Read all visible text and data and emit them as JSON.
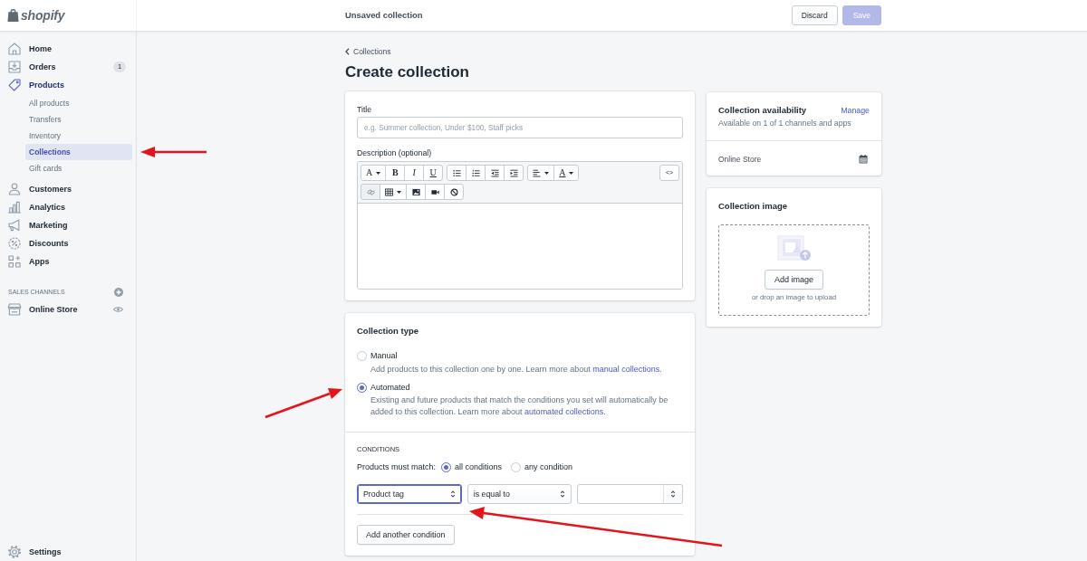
{
  "logo": "shopify",
  "top_bar": {
    "title": "Unsaved collection",
    "buttons": [
      {
        "label": "Discard",
        "kind": "secondary",
        "disabled": false
      },
      {
        "label": "Save",
        "kind": "primary",
        "disabled": true
      }
    ]
  },
  "sidebar": {
    "items": [
      {
        "label": "Home",
        "selected": false
      },
      {
        "label": "Orders",
        "selected": false,
        "badge": "1"
      },
      {
        "label": "Products",
        "selected": true,
        "children": [
          {
            "label": "All products",
            "selected": false
          },
          {
            "label": "Transfers",
            "selected": false
          },
          {
            "label": "Inventory",
            "selected": false
          },
          {
            "label": "Collections",
            "selected": true
          },
          {
            "label": "Gift cards",
            "selected": false
          }
        ]
      },
      {
        "label": "Customers",
        "selected": false
      },
      {
        "label": "Analytics",
        "selected": false
      },
      {
        "label": "Marketing",
        "selected": false
      },
      {
        "label": "Discounts",
        "selected": false
      },
      {
        "label": "Apps",
        "selected": false
      }
    ],
    "channels_heading": "SALES CHANNELS",
    "channels": [
      {
        "label": "Online Store",
        "selected": false
      }
    ],
    "settings": "Settings"
  },
  "page": {
    "breadcrumb": "Collections",
    "title": "Create collection"
  },
  "details": {
    "title_field": {
      "label": "Title",
      "placeholder": "e.g. Summer collection, Under $100, Staff picks"
    },
    "description": {
      "label": "Description (optional)",
      "toolbar": [
        {
          "groups": [
            [
              {
                "kind": "font",
                "glyph": "A",
                "dropdown": true,
                "disabled": false
              },
              {
                "kind": "bold",
                "glyph": "B",
                "dropdown": false,
                "disabled": false
              },
              {
                "kind": "italic",
                "glyph": "I",
                "dropdown": false,
                "disabled": false
              },
              {
                "kind": "underline",
                "glyph": "U",
                "dropdown": false,
                "disabled": false
              }
            ],
            [
              {
                "kind": "bullets",
                "dropdown": false,
                "disabled": false
              },
              {
                "kind": "numbers",
                "dropdown": false,
                "disabled": false
              },
              {
                "kind": "outdent",
                "dropdown": false,
                "disabled": false
              },
              {
                "kind": "indent",
                "dropdown": false,
                "disabled": false
              }
            ],
            [
              {
                "kind": "align",
                "dropdown": true,
                "disabled": false
              },
              {
                "kind": "color",
                "glyph": "A",
                "dropdown": true,
                "disabled": false
              }
            ]
          ],
          "end_tools": [
            {
              "kind": "code",
              "glyph": "<>",
              "dropdown": false,
              "disabled": false
            }
          ]
        },
        {
          "groups": [
            [
              {
                "kind": "link",
                "dropdown": false,
                "disabled": true
              },
              {
                "kind": "table",
                "dropdown": true,
                "disabled": false
              },
              {
                "kind": "image",
                "dropdown": false,
                "disabled": false
              },
              {
                "kind": "video",
                "dropdown": false,
                "disabled": false
              },
              {
                "kind": "clear",
                "dropdown": false,
                "disabled": false
              }
            ]
          ]
        }
      ]
    }
  },
  "collection_type": {
    "heading": "Collection type",
    "options": [
      {
        "label": "Manual",
        "selected": false,
        "description": {
          "text": "Add products to this collection one by one. Learn more about ",
          "link": "manual collections",
          "after": "."
        }
      },
      {
        "label": "Automated",
        "selected": true,
        "description": {
          "text": "Existing and future products that match the conditions you set will automatically be added to this collection. Learn more about ",
          "link": "automated collections",
          "after": "."
        }
      }
    ]
  },
  "conditions": {
    "heading": "CONDITIONS",
    "match_label": "Products must match:",
    "match_options": [
      {
        "label": "all conditions",
        "selected": true
      },
      {
        "label": "any condition",
        "selected": false
      }
    ],
    "rows": [
      {
        "selects": [
          {
            "kind": "select",
            "value": "Product tag",
            "focused": true
          },
          {
            "kind": "select",
            "value": "is equal to",
            "focused": false
          },
          {
            "kind": "combo",
            "focused": false
          }
        ]
      }
    ],
    "add_button": "Add another condition"
  },
  "availability": {
    "title": "Collection availability",
    "action": "Manage",
    "summary": "Available on 1 of 1 channels and apps",
    "channels": [
      {
        "name": "Online Store"
      }
    ]
  },
  "image": {
    "title": "Collection image",
    "button": "Add image",
    "hint": "or drop an image to upload"
  },
  "annotations": [
    {
      "kind": "arrow"
    },
    {
      "kind": "arrow"
    },
    {
      "kind": "arrow"
    }
  ]
}
